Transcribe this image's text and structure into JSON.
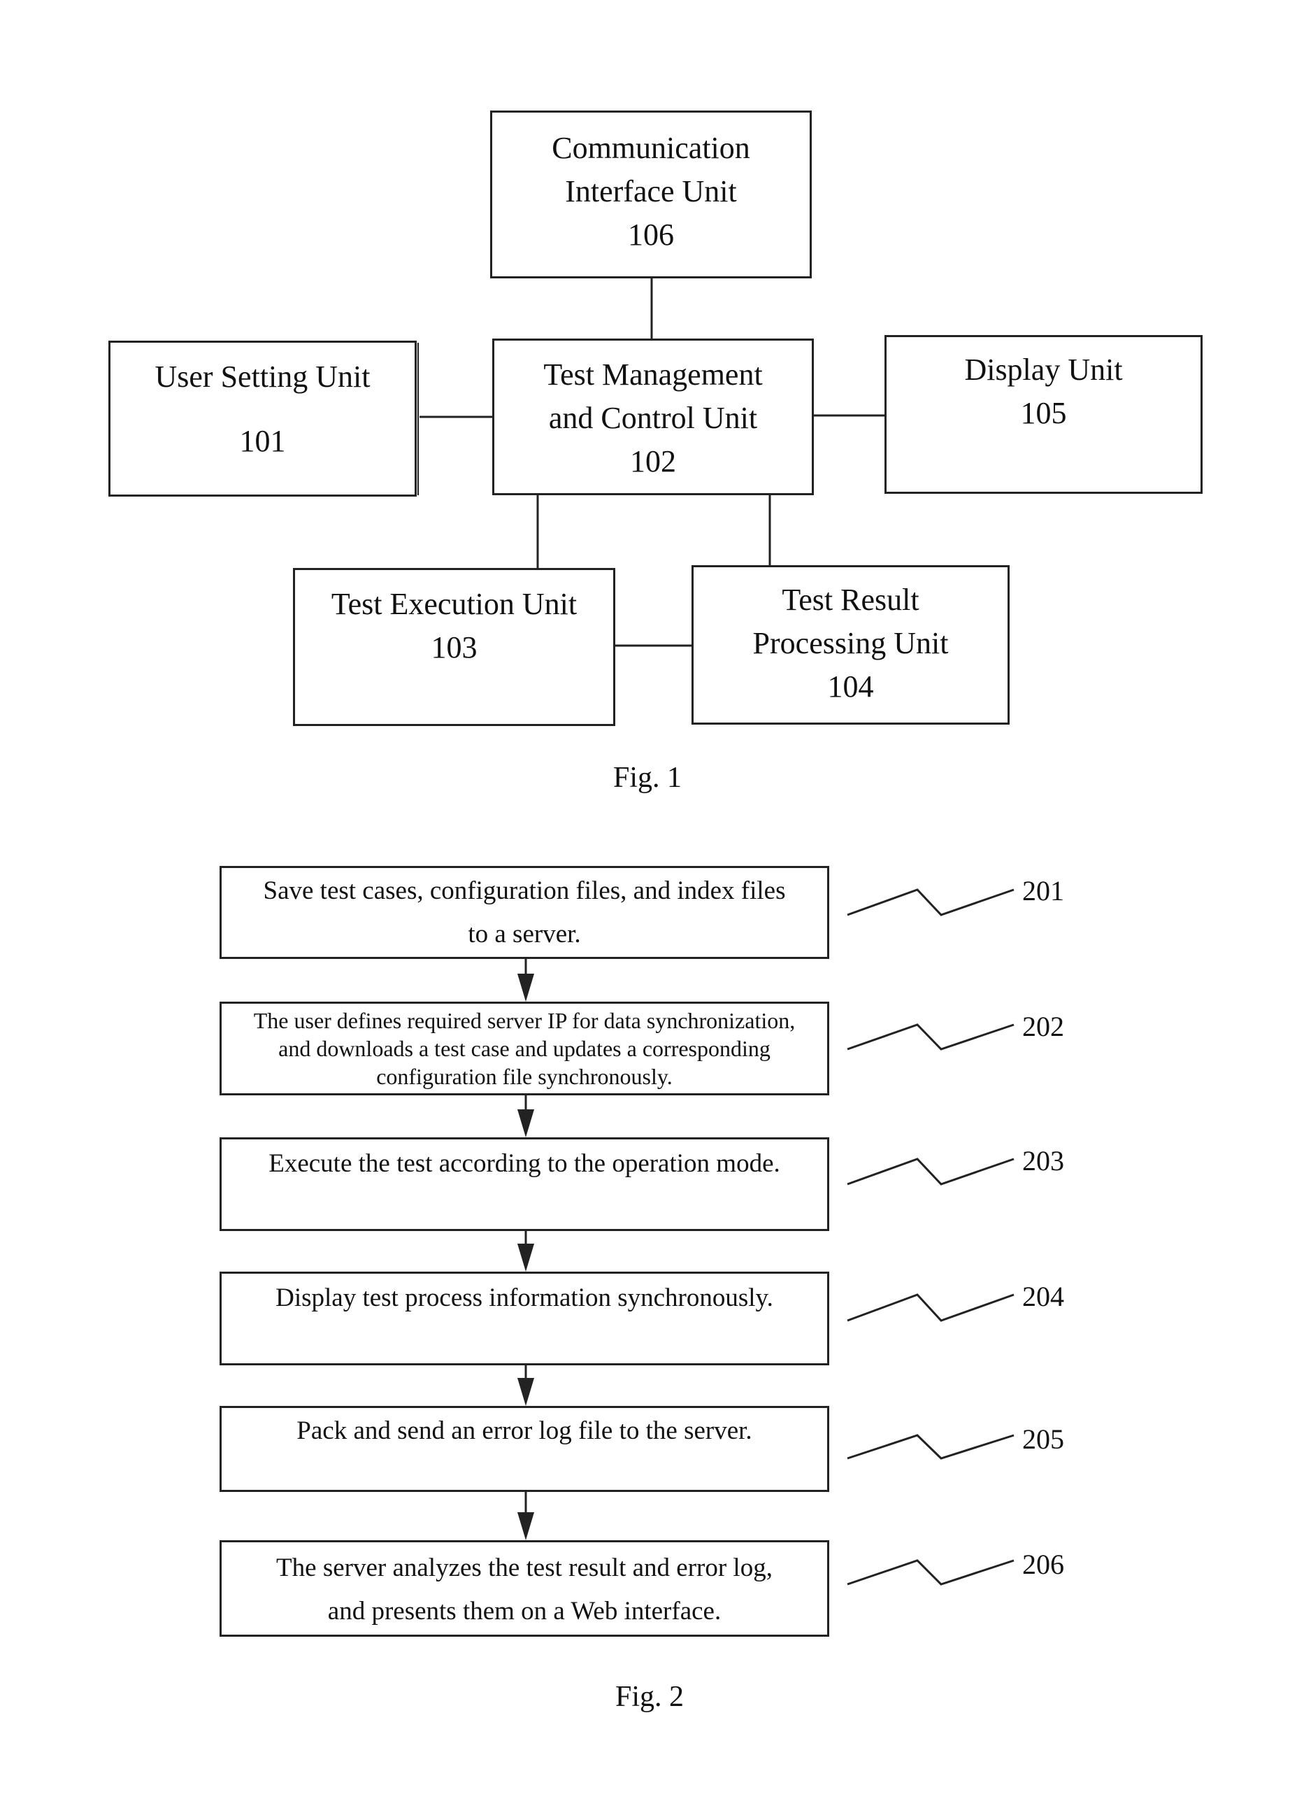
{
  "figure1": {
    "caption": "Fig. 1",
    "units": [
      {
        "id": "106",
        "lines": [
          "Communication",
          "Interface Unit",
          "106"
        ]
      },
      {
        "id": "101",
        "lines": [
          "User Setting Unit",
          "",
          "101"
        ]
      },
      {
        "id": "102",
        "lines": [
          "Test Management",
          "and Control Unit",
          "102"
        ]
      },
      {
        "id": "105",
        "lines": [
          "Display Unit",
          "105"
        ]
      },
      {
        "id": "103",
        "lines": [
          "Test Execution Unit",
          "103"
        ]
      },
      {
        "id": "104",
        "lines": [
          "Test Result",
          "Processing Unit",
          "104"
        ]
      }
    ]
  },
  "figure2": {
    "caption": "Fig. 2",
    "steps": [
      {
        "ref": "201",
        "lines": [
          "Save test cases, configuration files, and index files",
          "to a server."
        ]
      },
      {
        "ref": "202",
        "lines": [
          "The user defines required server IP for data synchronization,",
          "and downloads a test case and updates a corresponding",
          "configuration file synchronously."
        ]
      },
      {
        "ref": "203",
        "lines": [
          "Execute the test according to the operation mode."
        ]
      },
      {
        "ref": "204",
        "lines": [
          "Display test process information synchronously."
        ]
      },
      {
        "ref": "205",
        "lines": [
          "Pack and send an error log file to the server."
        ]
      },
      {
        "ref": "206",
        "lines": [
          "The server analyzes the test result and error log,",
          "and presents them on a Web interface."
        ]
      }
    ]
  }
}
